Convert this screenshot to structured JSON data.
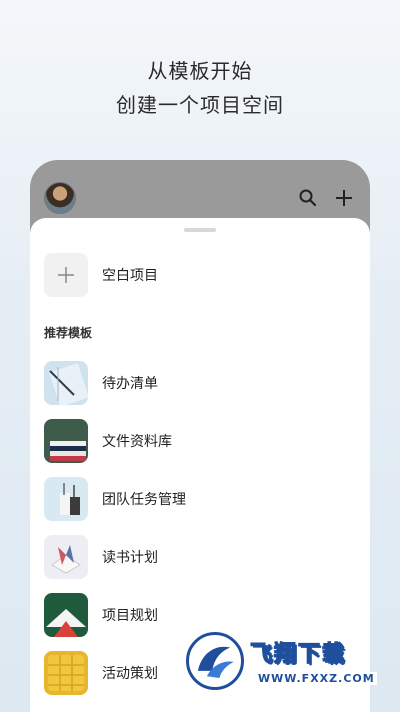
{
  "headline": {
    "line1": "从模板开始",
    "line2": "创建一个项目空间"
  },
  "toolbar": {
    "avatar_icon": "avatar-photo",
    "search_icon": "search-icon",
    "add_icon": "plus-icon"
  },
  "blank_project": {
    "label": "空白项目",
    "icon": "plus-icon"
  },
  "section": {
    "title": "推荐模板"
  },
  "templates": [
    {
      "label": "待办清单",
      "icon": "notebook-pen-thumbnail"
    },
    {
      "label": "文件资料库",
      "icon": "stacked-books-thumbnail"
    },
    {
      "label": "团队任务管理",
      "icon": "desk-supplies-thumbnail"
    },
    {
      "label": "读书计划",
      "icon": "open-book-thumbnail"
    },
    {
      "label": "项目规划",
      "icon": "house-roof-thumbnail"
    },
    {
      "label": "活动策划",
      "icon": "yellow-notebook-thumbnail"
    }
  ],
  "watermark": {
    "brand": "飞翔下载",
    "url": "WWW.FXXZ.COM"
  },
  "colors": {
    "sheet": "#ffffff",
    "phone_top": "#9a9a9a",
    "watermark_blue": "#1f4e9c"
  }
}
